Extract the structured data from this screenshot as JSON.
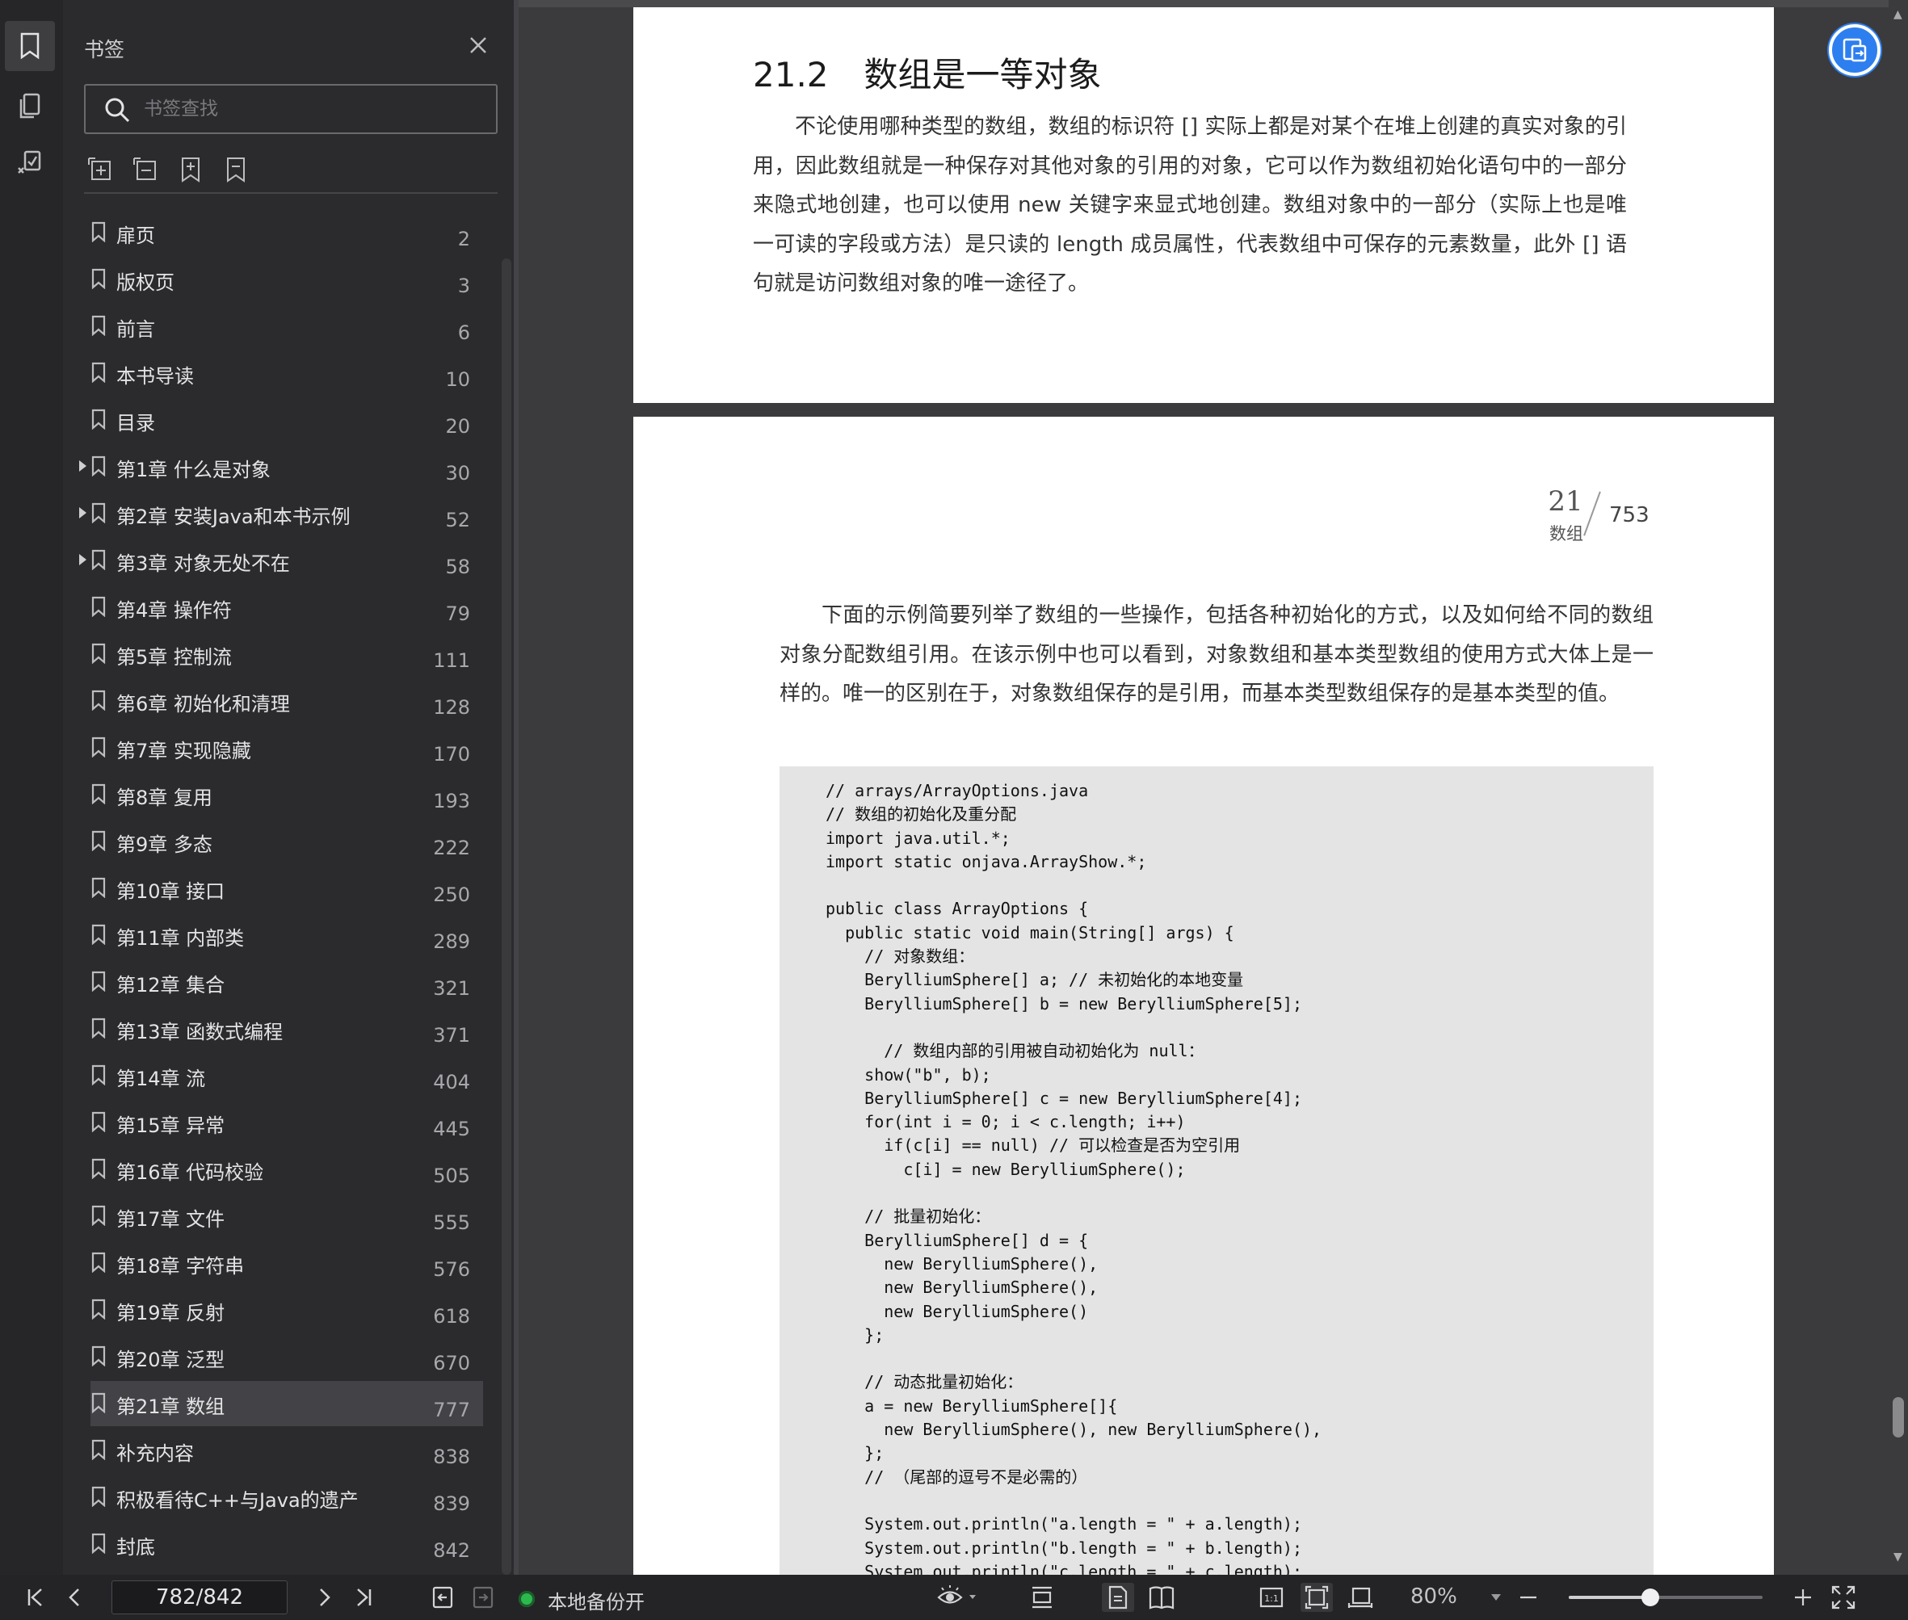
{
  "rail": {
    "items": [
      {
        "name": "bookmark-panel-icon",
        "active": true
      },
      {
        "name": "thumbnail-panel-icon",
        "active": false
      },
      {
        "name": "annotation-panel-icon",
        "active": false
      }
    ]
  },
  "sidebar": {
    "title": "书签",
    "search_placeholder": "书签查找",
    "tools": [
      "expand-all-icon",
      "collapse-all-icon",
      "add-bookmark-icon",
      "bookmark-icon"
    ],
    "items": [
      {
        "label": "扉页",
        "page": "2",
        "expandable": false
      },
      {
        "label": "版权页",
        "page": "3",
        "expandable": false
      },
      {
        "label": "前言",
        "page": "6",
        "expandable": false
      },
      {
        "label": "本书导读",
        "page": "10",
        "expandable": false
      },
      {
        "label": "目录",
        "page": "20",
        "expandable": false
      },
      {
        "label": "第1章 什么是对象",
        "page": "30",
        "expandable": true
      },
      {
        "label": "第2章 安装Java和本书示例",
        "page": "52",
        "expandable": true
      },
      {
        "label": "第3章 对象无处不在",
        "page": "58",
        "expandable": true
      },
      {
        "label": "第4章 操作符",
        "page": "79",
        "expandable": false
      },
      {
        "label": "第5章 控制流",
        "page": "111",
        "expandable": false
      },
      {
        "label": "第6章 初始化和清理",
        "page": "128",
        "expandable": false
      },
      {
        "label": "第7章 实现隐藏",
        "page": "170",
        "expandable": false
      },
      {
        "label": "第8章 复用",
        "page": "193",
        "expandable": false
      },
      {
        "label": "第9章 多态",
        "page": "222",
        "expandable": false
      },
      {
        "label": "第10章 接口",
        "page": "250",
        "expandable": false
      },
      {
        "label": "第11章 内部类",
        "page": "289",
        "expandable": false
      },
      {
        "label": "第12章 集合",
        "page": "321",
        "expandable": false
      },
      {
        "label": "第13章 函数式编程",
        "page": "371",
        "expandable": false
      },
      {
        "label": "第14章 流",
        "page": "404",
        "expandable": false
      },
      {
        "label": "第15章 异常",
        "page": "445",
        "expandable": false
      },
      {
        "label": "第16章 代码校验",
        "page": "505",
        "expandable": false
      },
      {
        "label": "第17章 文件",
        "page": "555",
        "expandable": false
      },
      {
        "label": "第18章 字符串",
        "page": "576",
        "expandable": false
      },
      {
        "label": "第19章 反射",
        "page": "618",
        "expandable": false
      },
      {
        "label": "第20章 泛型",
        "page": "670",
        "expandable": false
      },
      {
        "label": "第21章 数组",
        "page": "777",
        "expandable": false,
        "selected": true
      },
      {
        "label": "补充内容",
        "page": "838",
        "expandable": false
      },
      {
        "label": "积极看待C++与Java的遗产",
        "page": "839",
        "expandable": false
      },
      {
        "label": "封底",
        "page": "842",
        "expandable": false
      }
    ]
  },
  "document": {
    "page1": {
      "section_number": "21.2",
      "section_title": "数组是一等对象",
      "paragraph": "不论使用哪种类型的数组，数组的标识符 [] 实际上都是对某个在堆上创建的真实对象的引用，因此数组就是一种保存对其他对象的引用的对象，它可以作为数组初始化语句中的一部分来隐式地创建，也可以使用 new 关键字来显式地创建。数组对象中的一部分（实际上也是唯一可读的字段或方法）是只读的 length 成员属性，代表数组中可保存的元素数量，此外 [] 语句就是访问数组对象的唯一途径了。"
    },
    "page2": {
      "running_head_chapter": "21",
      "running_head_name": "数组",
      "page_number": "753",
      "paragraph": "下面的示例简要列举了数组的一些操作，包括各种初始化的方式，以及如何给不同的数组对象分配数组引用。在该示例中也可以看到，对象数组和基本类型数组的使用方式大体上是一样的。唯一的区别在于，对象数组保存的是引用，而基本类型数组保存的是基本类型的值。",
      "code": "// arrays/ArrayOptions.java\n// 数组的初始化及重分配\nimport java.util.*;\nimport static onjava.ArrayShow.*;\n\npublic class ArrayOptions {\n  public static void main(String[] args) {\n    // 对象数组：\n    BerylliumSphere[] a; // 未初始化的本地变量\n    BerylliumSphere[] b = new BerylliumSphere[5];\n\n      // 数组内部的引用被自动初始化为 null：\n    show(\"b\", b);\n    BerylliumSphere[] c = new BerylliumSphere[4];\n    for(int i = 0; i < c.length; i++)\n      if(c[i] == null) // 可以检查是否为空引用\n        c[i] = new BerylliumSphere();\n\n    // 批量初始化：\n    BerylliumSphere[] d = {\n      new BerylliumSphere(),\n      new BerylliumSphere(),\n      new BerylliumSphere()\n    };\n\n    // 动态批量初始化：\n    a = new BerylliumSphere[]{\n      new BerylliumSphere(), new BerylliumSphere(),\n    };\n    // （尾部的逗号不是必需的）\n\n    System.out.println(\"a.length = \" + a.length);\n    System.out.println(\"b.length = \" + b.length);\n    System.out.println(\"c.length = \" + c.length);"
    }
  },
  "statusbar": {
    "page_indicator": "782/842",
    "backup_status": "本地备份开",
    "zoom": "80%",
    "zoom_level": 0.42
  },
  "colors": {
    "accent": "#2d7ff0",
    "backup_green": "#2db84d"
  }
}
